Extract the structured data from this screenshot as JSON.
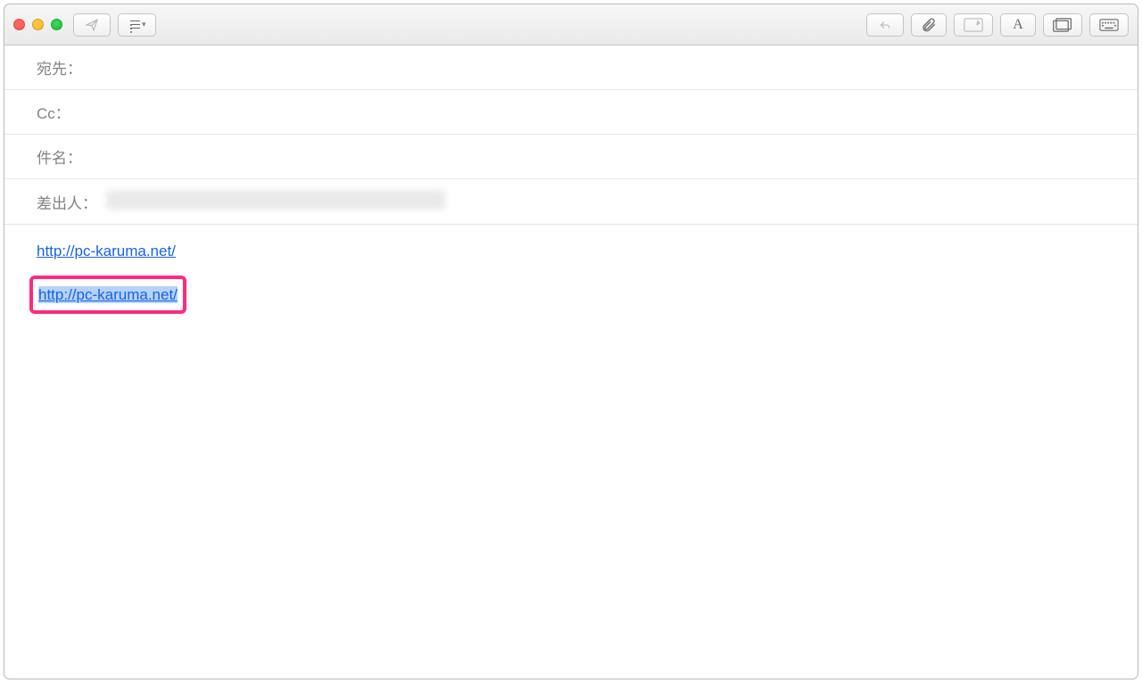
{
  "window": {
    "traffic_lights": {
      "close": "close",
      "minimize": "minimize",
      "zoom": "zoom"
    }
  },
  "toolbar": {
    "send": "send",
    "header_menu": "header-fields",
    "reply": "reply",
    "attach": "attach",
    "markup": "insert-image",
    "format": "format",
    "photo_browser": "photo-browser",
    "emoji": "emoji-symbols"
  },
  "headers": {
    "to_label": "宛先：",
    "cc_label": "Cc：",
    "subject_label": "件名：",
    "from_label": "差出人：",
    "to_value": "",
    "cc_value": "",
    "subject_value": "",
    "from_value": "[redacted]"
  },
  "body": {
    "link1_text": "http://pc-karuma.net/",
    "link1_href": "http://pc-karuma.net/",
    "link2_text": "http://pc-karuma.net/",
    "link2_href": "http://pc-karuma.net/",
    "link2_highlighted": true
  },
  "colors": {
    "link": "#1463e5",
    "highlight_border": "#ff2a7f",
    "highlight_bg": "#b6d2fb"
  }
}
